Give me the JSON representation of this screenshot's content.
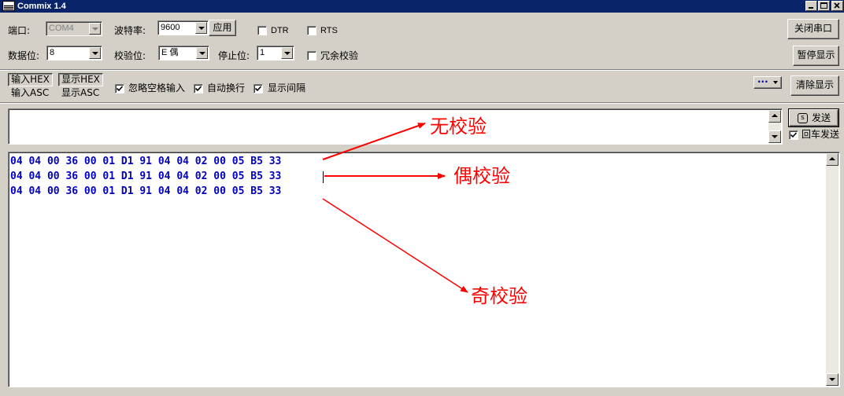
{
  "window": {
    "title": "Commix 1.4"
  },
  "settings": {
    "port_label": "端口:",
    "port_value": "COM4",
    "baud_label": "波特率:",
    "baud_value": "9600",
    "apply_label": "应用",
    "dtr_label": "DTR",
    "rts_label": "RTS",
    "data_bits_label": "数据位:",
    "data_bits_value": "8",
    "parity_label": "校验位:",
    "parity_value": "E 偶",
    "stop_bits_label": "停止位:",
    "stop_bits_value": "1",
    "redundant_check_label": "冗余校验",
    "close_port_label": "关闭串口",
    "pause_display_label": "暂停显示"
  },
  "mode": {
    "input_hex": "输入HEX",
    "input_asc": "输入ASC",
    "display_hex": "显示HEX",
    "display_asc": "显示ASC",
    "ignore_spaces_label": "忽略空格输入",
    "auto_newline_label": "自动换行",
    "show_interval_label": "显示间隔",
    "more_label": "···",
    "clear_display_label": "清除显示"
  },
  "send": {
    "send_label": "发送",
    "send_hotkey": "s",
    "enter_send_label": "回车发送",
    "input_value": ""
  },
  "receive": {
    "lines": [
      "04 04 00 36 00 01 D1 91 04 04 02 00 05 B5 33",
      "04 04 00 36 00 01 D1 91 04 04 02 00 05 B5 33",
      "04 04 00 36 00 01 D1 91 04 04 02 00 05 B5 33"
    ]
  },
  "annotations": {
    "no_parity": "无校验",
    "even_parity": "偶校验",
    "odd_parity": "奇校验",
    "color": "#ff0000"
  },
  "checks": {
    "dtr": false,
    "rts": false,
    "redundant_check": false,
    "ignore_spaces": true,
    "auto_newline": true,
    "show_interval": true,
    "enter_send": true
  },
  "colors": {
    "titlebar": "#0a246a",
    "hex_text": "#0000c0",
    "face": "#d4d0c8"
  }
}
